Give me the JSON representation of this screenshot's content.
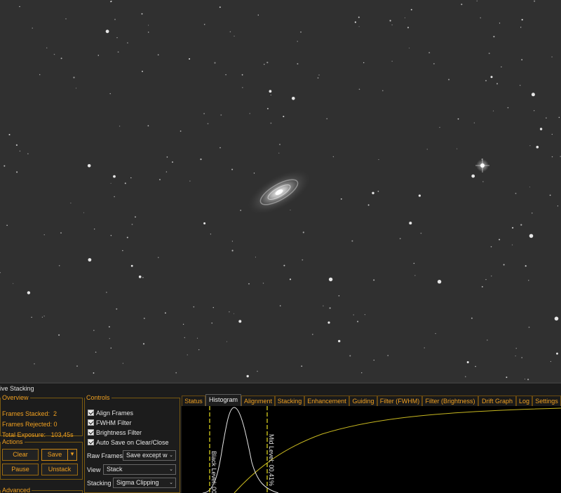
{
  "panel": {
    "title": "ive Stacking",
    "overview": {
      "legend": "Overview",
      "frames_stacked_label": "Frames Stacked:",
      "frames_stacked_value": "2",
      "frames_rejected_label": "Frames Rejected:",
      "frames_rejected_value": "0",
      "total_exposure_label": "Total Exposure:",
      "total_exposure_value": "103,45s"
    },
    "actions": {
      "legend": "Actions",
      "clear": "Clear",
      "save": "Save",
      "pause": "Pause",
      "unstack": "Unstack"
    },
    "advanced_legend": "Advanced",
    "controls": {
      "legend": "Controls",
      "checkboxes": [
        "Align Frames",
        "FWHM Filter",
        "Brightness Filter",
        "Auto Save on Clear/Close"
      ],
      "raw_frames_label": "Raw Frames",
      "raw_frames_value": "Save except w",
      "view_label": "View",
      "view_value": "Stack",
      "stacking_label": "Stacking",
      "stacking_value": "Sigma Clipping"
    },
    "tabs": [
      "Status",
      "Histogram",
      "Alignment",
      "Stacking",
      "Enhancement",
      "Guiding",
      "Filter (FWHM)",
      "Filter (Brightness)",
      "Drift Graph",
      "Log",
      "Settings"
    ],
    "active_tab": "Histogram",
    "histogram": {
      "black_level_label": "Black Level: 00",
      "mid_level_label": "Mid Level: 00,41%"
    }
  },
  "colors": {
    "accent": "#f0a020",
    "level_line": "#e8e020",
    "curve": "#c8b820"
  }
}
